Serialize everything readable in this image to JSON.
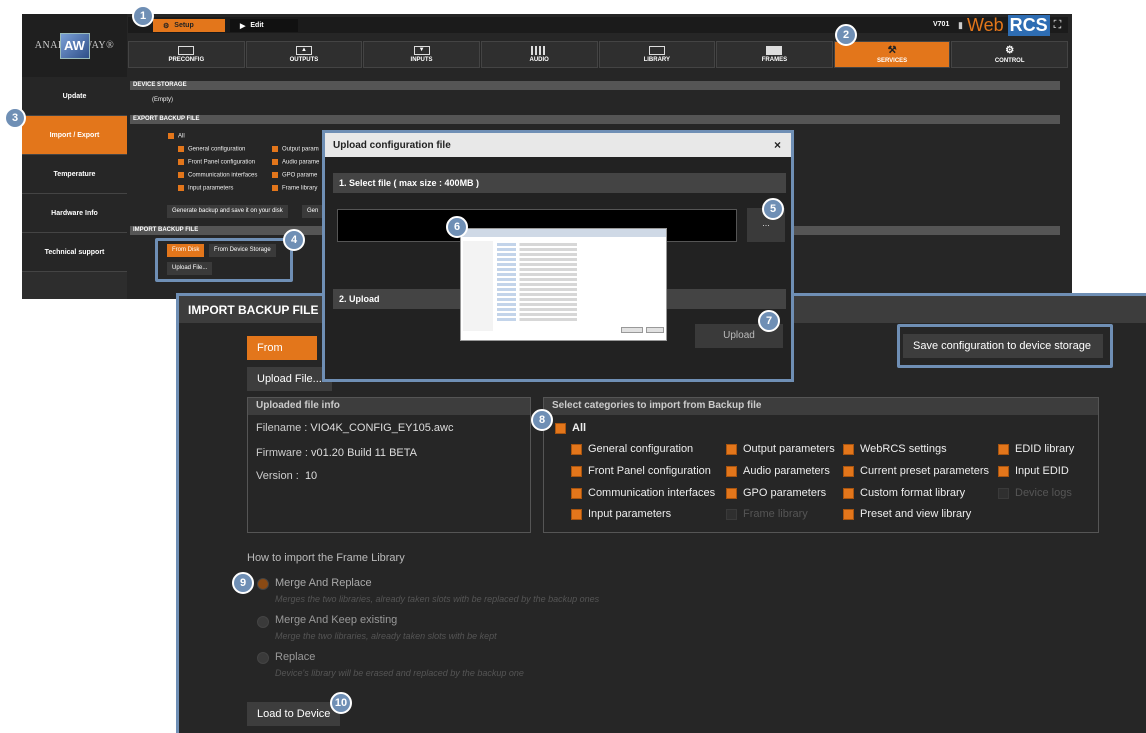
{
  "app": {
    "logo_text": "ANALOG WAY®",
    "logo_mark": "AW",
    "mode_tabs": [
      {
        "label": "Setup",
        "icon": "gear-icon"
      },
      {
        "label": "Edit",
        "icon": "play-icon"
      }
    ],
    "version": "V701",
    "brand_web": "Web",
    "brand_rcs": "RCS"
  },
  "nav": [
    {
      "label": "PRECONFIG"
    },
    {
      "label": "OUTPUTS"
    },
    {
      "label": "INPUTS"
    },
    {
      "label": "AUDIO"
    },
    {
      "label": "LIBRARY"
    },
    {
      "label": "FRAMES"
    },
    {
      "label": "SERVICES",
      "active": true
    },
    {
      "label": "CONTROL"
    }
  ],
  "sidebar": [
    {
      "label": "Update"
    },
    {
      "label": "Import / Export",
      "active": true
    },
    {
      "label": "Temperature"
    },
    {
      "label": "Hardware Info"
    },
    {
      "label": "Technical support"
    }
  ],
  "bg": {
    "device_storage": "DEVICE STORAGE",
    "empty": "(Empty)",
    "export_backup": "EXPORT BACKUP FILE",
    "all": "All",
    "export_items": [
      "General configuration",
      "Output param",
      "Front Panel configuration",
      "Audio parame",
      "Communication interfaces",
      "GPO parame",
      "Input parameters",
      "Frame library"
    ],
    "generate_btn": "Generate backup and save it on your disk",
    "gen_btn2": "Gen",
    "import_backup": "IMPORT BACKUP FILE",
    "from_disk": "From Disk",
    "from_device": "From Device Storage",
    "upload_file": "Upload File..."
  },
  "dialog": {
    "title": "Upload configuration file",
    "close": "×",
    "step1": "1. Select file ( max size : 400MB )",
    "dots": "...",
    "step2": "2. Upload",
    "upload": "Upload"
  },
  "panel": {
    "title": "IMPORT BACKUP FILE",
    "from_disk": "From Disk",
    "save_btn": "Save configuration to device storage",
    "upload_file": "Upload File...",
    "uploaded_header": "Uploaded file info",
    "filename_label": "Filename :",
    "filename": "VIO4K_CONFIG_EY105.awc",
    "firmware_label": "Firmware :",
    "firmware": "v01.20 Build 11 BETA",
    "version_label": "Version :",
    "version": "10",
    "categories_header": "Select categories to import from Backup file",
    "all": "All",
    "categories": [
      {
        "label": "General configuration",
        "enabled": true
      },
      {
        "label": "Output parameters",
        "enabled": true
      },
      {
        "label": "WebRCS settings",
        "enabled": true
      },
      {
        "label": "EDID library",
        "enabled": true
      },
      {
        "label": "Front Panel configuration",
        "enabled": true
      },
      {
        "label": "Audio parameters",
        "enabled": true
      },
      {
        "label": "Current preset parameters",
        "enabled": true
      },
      {
        "label": "Input EDID",
        "enabled": true
      },
      {
        "label": "Communication interfaces",
        "enabled": true
      },
      {
        "label": "GPO parameters",
        "enabled": true
      },
      {
        "label": "Custom format library",
        "enabled": true
      },
      {
        "label": "Device logs",
        "enabled": false
      },
      {
        "label": "Input parameters",
        "enabled": true
      },
      {
        "label": "Frame library",
        "enabled": false
      },
      {
        "label": "Preset and view library",
        "enabled": true
      }
    ],
    "frame_lib_title": "How to import the Frame Library",
    "options": [
      {
        "label": "Merge And Replace",
        "desc": "Merges the two libraries, already taken slots with be replaced by the backup ones",
        "selected": true
      },
      {
        "label": "Merge And Keep existing",
        "desc": "Merge the two libraries, already taken slots with be kept",
        "selected": false
      },
      {
        "label": "Replace",
        "desc": "Device's library will be erased and replaced by the backup one",
        "selected": false
      }
    ],
    "load_btn": "Load to Device"
  },
  "badges": [
    "1",
    "2",
    "3",
    "4",
    "5",
    "6",
    "7",
    "8",
    "9",
    "10"
  ],
  "colors": {
    "accent": "#e3761b",
    "highlight": "#6f8fb5",
    "bg": "#262626"
  }
}
